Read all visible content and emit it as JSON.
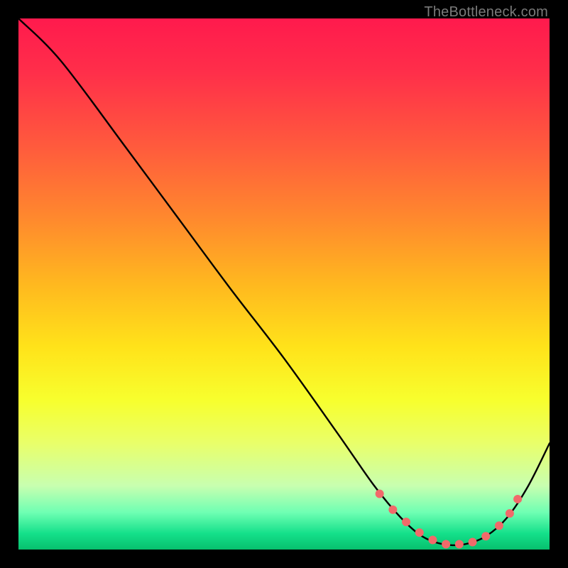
{
  "watermark": "TheBottleneck.com",
  "colors": {
    "background": "#000000",
    "curve_stroke": "#000000",
    "marker_fill": "#f16a6a",
    "marker_stroke": "#f16a6a"
  },
  "chart_data": {
    "type": "line",
    "title": "",
    "xlabel": "",
    "ylabel": "",
    "xlim": [
      0,
      100
    ],
    "ylim": [
      0,
      100
    ],
    "grid": false,
    "series": [
      {
        "name": "curve",
        "x": [
          0,
          8,
          20,
          30,
          40,
          50,
          60,
          67,
          72,
          76,
          80,
          84,
          88,
          92,
          96,
          100
        ],
        "y": [
          100,
          92,
          76,
          62.5,
          49,
          36,
          22,
          12,
          6,
          2.5,
          1,
          1,
          2.5,
          6,
          12,
          20
        ]
      }
    ],
    "markers": {
      "name": "dots",
      "x": [
        68,
        70.5,
        73,
        75.5,
        78,
        80.5,
        83,
        85.5,
        88,
        90.5,
        92.5,
        94
      ],
      "y": [
        10.5,
        7.5,
        5.2,
        3.2,
        1.8,
        1.0,
        1.0,
        1.4,
        2.5,
        4.5,
        6.8,
        9.5
      ]
    }
  }
}
